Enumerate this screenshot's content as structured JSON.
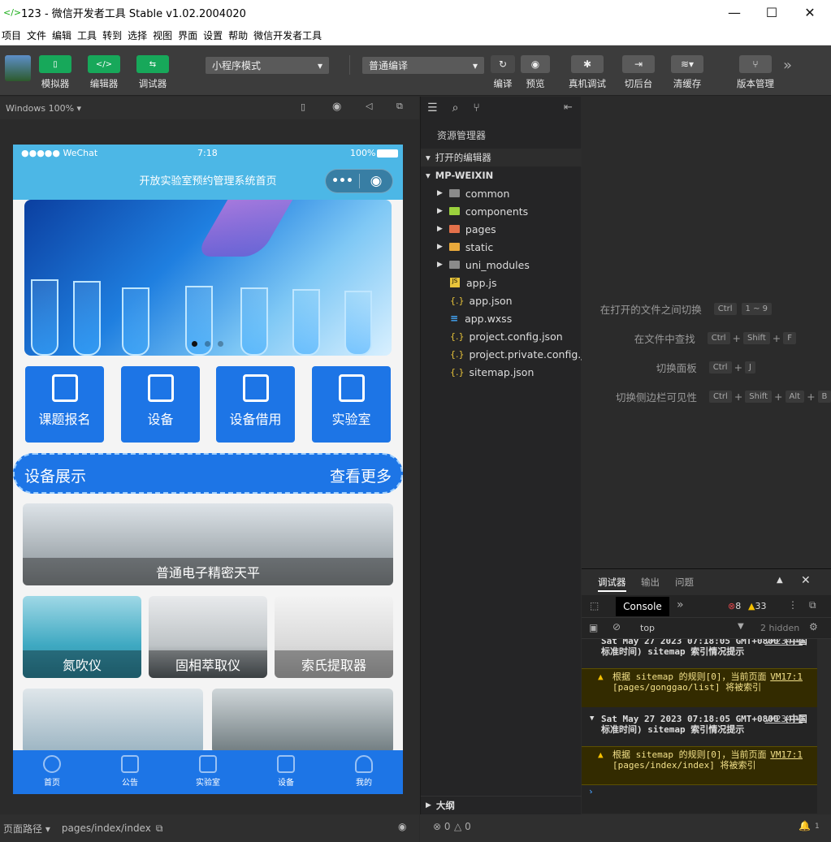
{
  "window": {
    "title": "123 - 微信开发者工具 Stable v1.02.2004020"
  },
  "menu": [
    "项目",
    "文件",
    "编辑",
    "工具",
    "转到",
    "选择",
    "视图",
    "界面",
    "设置",
    "帮助",
    "微信开发者工具"
  ],
  "toolbar": {
    "simulator": "模拟器",
    "editor": "编辑器",
    "debugger": "调试器",
    "mode_select": "小程序模式",
    "compile_select": "普通编译",
    "compile": "编译",
    "preview": "预览",
    "real_debug": "真机调试",
    "background": "切后台",
    "clear_cache": "清缓存",
    "version": "版本管理"
  },
  "simulator": {
    "device": "Windows 100%",
    "status": {
      "carrier": "●●●●● WeChat",
      "time": "7:18",
      "battery": "100%"
    },
    "nav_title": "开放实验室预约管理系统首页",
    "categories": [
      "课题报名",
      "设备",
      "设备借用",
      "实验室"
    ],
    "showcase": {
      "title": "设备展示",
      "more": "查看更多"
    },
    "items": [
      "普通电子精密天平",
      "氮吹仪",
      "固相萃取仪",
      "索氏提取器"
    ],
    "tabs": [
      "首页",
      "公告",
      "实验室",
      "设备",
      "我的"
    ]
  },
  "pathbar": {
    "label": "页面路径",
    "path": "pages/index/index"
  },
  "explorer": {
    "title": "资源管理器",
    "open_editors": "打开的编辑器",
    "project": "MP-WEIXIN",
    "folders": [
      "common",
      "components",
      "pages",
      "static",
      "uni_modules"
    ],
    "files": [
      "app.js",
      "app.json",
      "app.wxss",
      "project.config.json",
      "project.private.config.js...",
      "sitemap.json"
    ],
    "outline": "大纲"
  },
  "shortcuts": [
    {
      "label": "在打开的文件之间切换",
      "keys": [
        "Ctrl",
        "1 ~ 9"
      ]
    },
    {
      "label": "在文件中查找",
      "keys": [
        "Ctrl",
        "Shift",
        "F"
      ]
    },
    {
      "label": "切换面板",
      "keys": [
        "Ctrl",
        "J"
      ]
    },
    {
      "label": "切换侧边栏可见性",
      "keys": [
        "Ctrl",
        "Shift",
        "Alt",
        "B"
      ]
    }
  ],
  "debugger": {
    "tabs": [
      "调试器",
      "输出",
      "问题"
    ],
    "console_tab": "Console",
    "errors": "8",
    "warnings": "33",
    "context": "top",
    "hidden": "2 hidden",
    "logs": [
      {
        "type": "info",
        "text": "Sat May 27 2023 07:18:05 GMT+0800 (中国标准时间) sitemap 索引情况提示",
        "src": "VM234:4"
      },
      {
        "type": "warn",
        "text": "根据 sitemap 的规则[0]，当前页面 [pages/gonggao/list] 将被索引",
        "src": "VM17:1"
      },
      {
        "type": "info",
        "text": "Sat May 27 2023 07:18:05 GMT+0800 (中国标准时间) sitemap 索引情况提示",
        "src": "VM234:4"
      },
      {
        "type": "warn",
        "text": "根据 sitemap 的规则[0]，当前页面 [pages/index/index] 将被索引",
        "src": "VM17:1"
      }
    ]
  },
  "bottombar": {
    "errors": "0",
    "warnings": "0",
    "notifications": "1"
  },
  "colors": {
    "accent": "#1d75e6",
    "nav": "#4cb7e6",
    "green": "#17a85a"
  }
}
